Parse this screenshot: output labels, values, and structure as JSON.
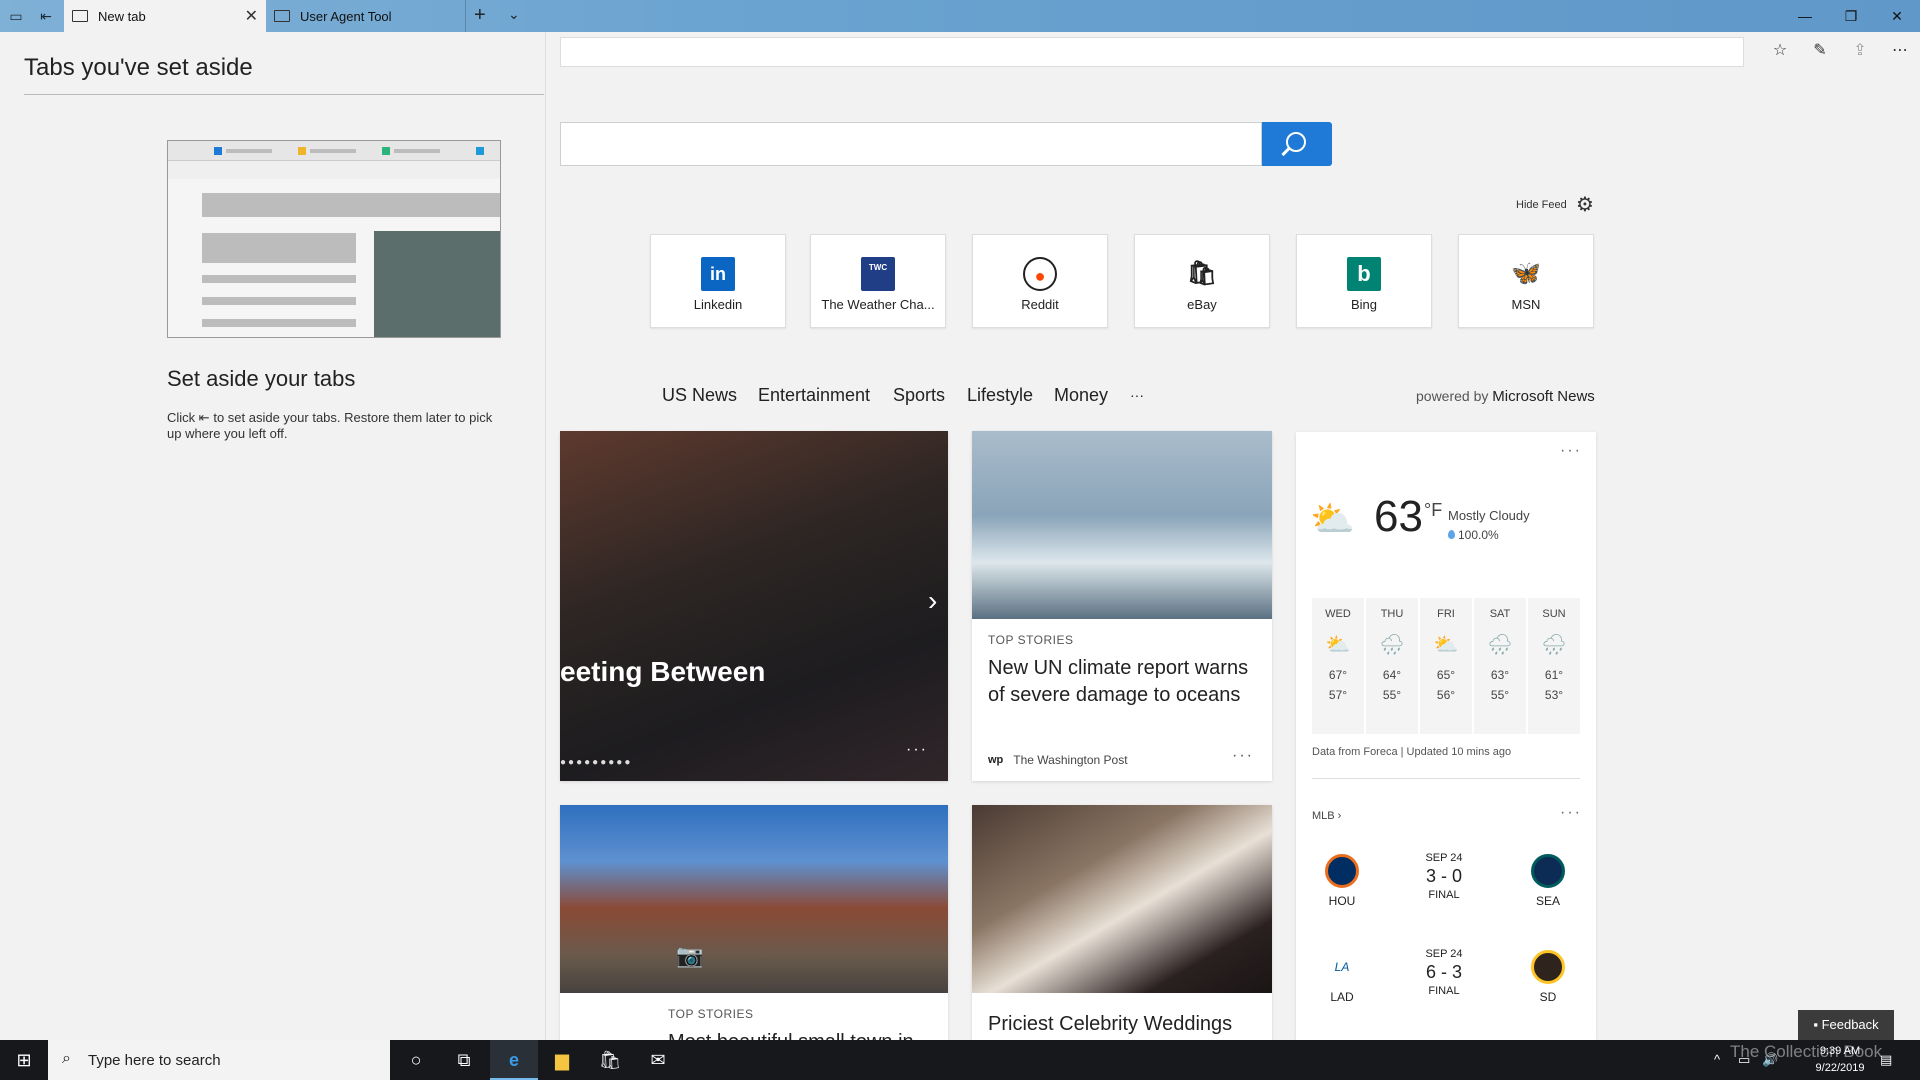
{
  "tabs": [
    {
      "label": "New tab",
      "active": true
    },
    {
      "label": "User Agent Tool",
      "active": false
    }
  ],
  "aside": {
    "title": "Tabs you've set aside",
    "heading": "Set aside your tabs",
    "desc_pre": "Click",
    "desc_post": "to set aside your tabs. Restore them later to pick up where you left off."
  },
  "newtab": {
    "hide_feed": "Hide Feed",
    "tiles": [
      {
        "label": "Linkedin",
        "logo": "in",
        "color": "#0a66c2"
      },
      {
        "label": "The Weather Cha...",
        "logo": "TWC",
        "color": "#1f3e86"
      },
      {
        "label": "Reddit",
        "logo": "●",
        "color": "#ff4500"
      },
      {
        "label": "eBay",
        "logo": "🛍",
        "color": "#222222"
      },
      {
        "label": "Bing",
        "logo": "b",
        "color": "#008373"
      },
      {
        "label": "MSN",
        "logo": "🦋",
        "color": "#111111"
      }
    ],
    "feed_nav": [
      "US News",
      "Entertainment",
      "Sports",
      "Lifestyle",
      "Money",
      "···"
    ],
    "powered_pre": "powered by",
    "powered_brand": "Microsoft News",
    "hero_title": "eeting Between",
    "story1": {
      "cat": "TOP STORIES",
      "title": "New UN climate report warns of severe damage to oceans",
      "source": "The Washington Post",
      "source_logo": "wp"
    },
    "story2": {
      "cat": "TOP STORIES",
      "title": "Most beautiful small town in..."
    },
    "story3": {
      "title": "Priciest Celebrity Weddings"
    }
  },
  "weather": {
    "temp": "63",
    "unit": "°F",
    "condition": "Mostly Cloudy",
    "precip": "100.0%",
    "days": [
      {
        "d": "WED",
        "hi": "67°",
        "lo": "57°",
        "icon": "⛅"
      },
      {
        "d": "THU",
        "hi": "64°",
        "lo": "55°",
        "icon": "🌧"
      },
      {
        "d": "FRI",
        "hi": "65°",
        "lo": "56°",
        "icon": "⛅"
      },
      {
        "d": "SAT",
        "hi": "63°",
        "lo": "55°",
        "icon": "🌧"
      },
      {
        "d": "SUN",
        "hi": "61°",
        "lo": "53°",
        "icon": "🌧"
      }
    ],
    "credit": "Data from Foreca | Updated 10 mins ago",
    "mlb": "MLB",
    "games": [
      {
        "home": "HOU",
        "away": "SEA",
        "date": "SEP 24",
        "score": "3 - 0",
        "status": "FINAL",
        "home_color": "#002d62",
        "away_color": "#0c2c56"
      },
      {
        "home": "LAD",
        "away": "SD",
        "date": "SEP 24",
        "score": "6 - 3",
        "status": "FINAL",
        "home_color": "#005a9c",
        "away_color": "#2f241d"
      }
    ]
  },
  "feedback": "Feedback",
  "taskbar": {
    "search_placeholder": "Type here to search",
    "time": "9:39 AM",
    "date": "9/22/2019",
    "watermark": "The Collection Book"
  }
}
